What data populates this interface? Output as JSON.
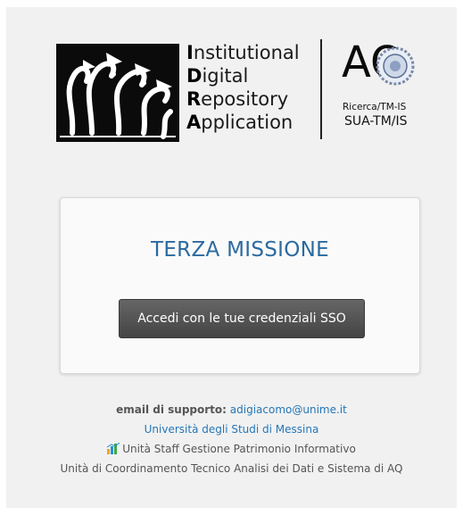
{
  "logo": {
    "idra_lines": [
      {
        "initial": "I",
        "rest": "nstitutional"
      },
      {
        "initial": "D",
        "rest": "igital"
      },
      {
        "initial": "R",
        "rest": "epository"
      },
      {
        "initial": "A",
        "rest": "pplication"
      }
    ],
    "aq_letters": "AQ",
    "aq_subtitle": "Ricerca/TM-IS",
    "aq_subtitle2": "SUA-TM/IS"
  },
  "card": {
    "title": "TERZA MISSIONE",
    "sso_button": "Accedi con le tue credenziali SSO"
  },
  "footer": {
    "support_label": "email di supporto:",
    "support_email": "adigiacomo@unime.it",
    "university": "Università degli Studi di Messina",
    "staff_unit": "Unità Staff Gestione Patrimonio Informativo",
    "coordination_unit": "Unità di Coordinamento Tecnico Analisi dei Dati e Sistema di AQ"
  }
}
